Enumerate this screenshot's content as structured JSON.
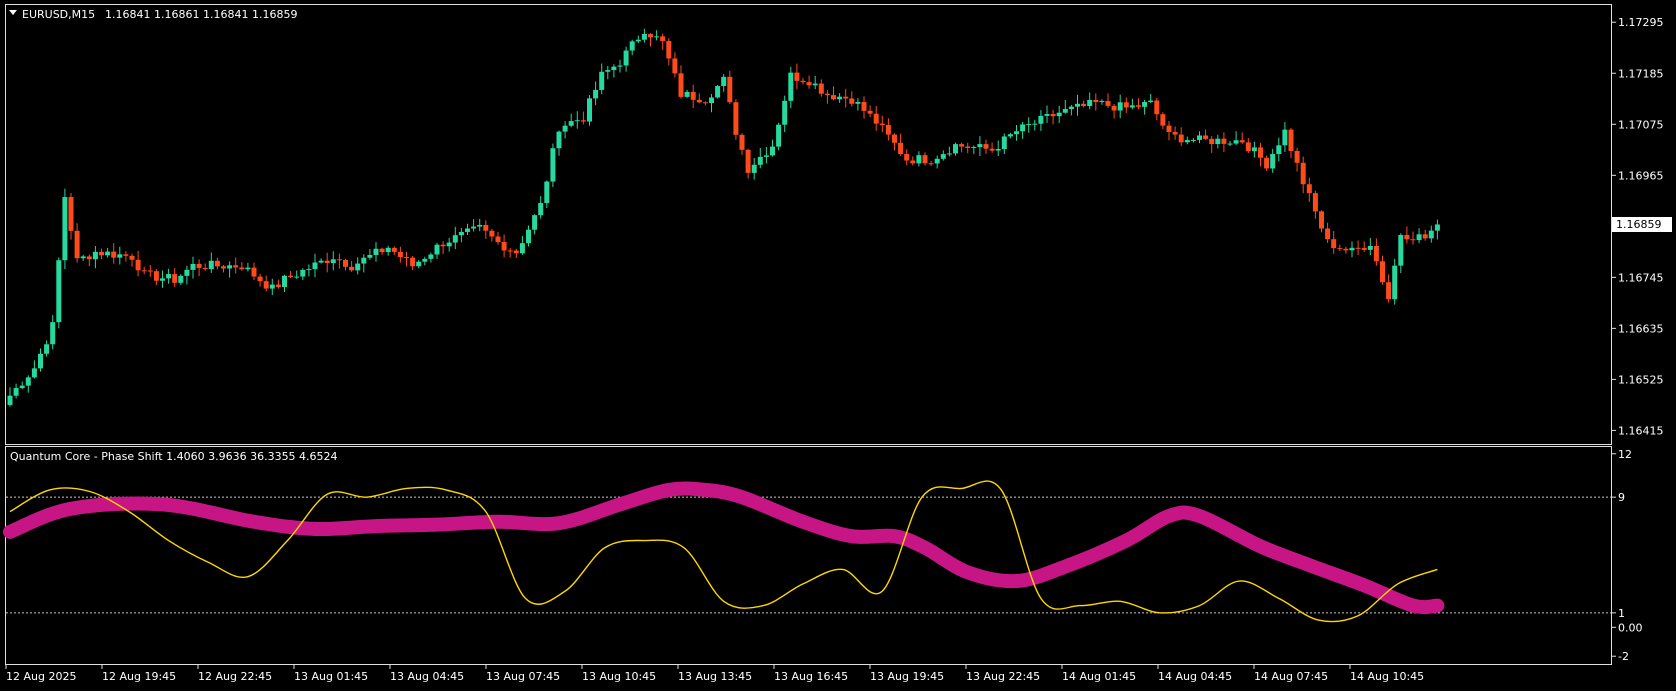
{
  "window": {
    "symbol_label": "EURUSD,M15",
    "ohlc_label": "1.16841 1.16861 1.16841 1.16859",
    "menu_icon": "triangle-down-icon"
  },
  "colors": {
    "background": "#000000",
    "bull": "#26d9a0",
    "bear": "#ff4a1c",
    "fast_line": "#ffd700",
    "slow_line": "#c71585",
    "frame": "#e0e0e0"
  },
  "price_axis": {
    "labels": [
      "1.17295",
      "1.17185",
      "1.17075",
      "1.16965",
      "1.16745",
      "1.16635",
      "1.16525",
      "1.16415"
    ],
    "current_price": "1.16859"
  },
  "indicator": {
    "title": "Quantum Core - Phase Shift 1.4060 3.9636 36.3355 4.6524",
    "axis_labels": [
      "12",
      "9",
      "1",
      "0.00",
      "-2"
    ],
    "levels": [
      9,
      1
    ]
  },
  "time_axis": {
    "labels": [
      "12 Aug 2025",
      "12 Aug 19:45",
      "12 Aug 22:45",
      "13 Aug 01:45",
      "13 Aug 04:45",
      "13 Aug 07:45",
      "13 Aug 10:45",
      "13 Aug 13:45",
      "13 Aug 16:45",
      "13 Aug 19:45",
      "13 Aug 22:45",
      "14 Aug 01:45",
      "14 Aug 04:45",
      "14 Aug 07:45",
      "14 Aug 10:45"
    ]
  },
  "chart_data": [
    {
      "type": "candlestick",
      "title": "EURUSD,M15",
      "ylim": [
        1.1639,
        1.1733
      ],
      "x_interval_minutes": 15,
      "first_bar": "12 Aug 2025 16:45",
      "last_bar": "14 Aug 12:45",
      "anchors": [
        {
          "bar": 0,
          "price": 1.1649
        },
        {
          "bar": 4,
          "price": 1.1655
        },
        {
          "bar": 7,
          "price": 1.1664
        },
        {
          "bar": 9,
          "price": 1.1692
        },
        {
          "bar": 11,
          "price": 1.1678
        },
        {
          "bar": 14,
          "price": 1.168
        },
        {
          "bar": 20,
          "price": 1.1679
        },
        {
          "bar": 22,
          "price": 1.1675
        },
        {
          "bar": 27,
          "price": 1.1674
        },
        {
          "bar": 30,
          "price": 1.1677
        },
        {
          "bar": 38,
          "price": 1.1677
        },
        {
          "bar": 43,
          "price": 1.1672
        },
        {
          "bar": 45,
          "price": 1.1674
        },
        {
          "bar": 53,
          "price": 1.1679
        },
        {
          "bar": 56,
          "price": 1.1677
        },
        {
          "bar": 62,
          "price": 1.1681
        },
        {
          "bar": 66,
          "price": 1.1677
        },
        {
          "bar": 71,
          "price": 1.1682
        },
        {
          "bar": 77,
          "price": 1.1685
        },
        {
          "bar": 80,
          "price": 1.1682
        },
        {
          "bar": 83,
          "price": 1.168
        },
        {
          "bar": 87,
          "price": 1.169
        },
        {
          "bar": 90,
          "price": 1.1707
        },
        {
          "bar": 94,
          "price": 1.1709
        },
        {
          "bar": 97,
          "price": 1.1718
        },
        {
          "bar": 100,
          "price": 1.1721
        },
        {
          "bar": 104,
          "price": 1.1728
        },
        {
          "bar": 107,
          "price": 1.1725
        },
        {
          "bar": 110,
          "price": 1.1714
        },
        {
          "bar": 114,
          "price": 1.1713
        },
        {
          "bar": 117,
          "price": 1.1717
        },
        {
          "bar": 119,
          "price": 1.1706
        },
        {
          "bar": 121,
          "price": 1.1698
        },
        {
          "bar": 125,
          "price": 1.1703
        },
        {
          "bar": 128,
          "price": 1.1718
        },
        {
          "bar": 131,
          "price": 1.1717
        },
        {
          "bar": 134,
          "price": 1.1714
        },
        {
          "bar": 138,
          "price": 1.1713
        },
        {
          "bar": 142,
          "price": 1.1708
        },
        {
          "bar": 147,
          "price": 1.17
        },
        {
          "bar": 151,
          "price": 1.17
        },
        {
          "bar": 155,
          "price": 1.1703
        },
        {
          "bar": 161,
          "price": 1.1702
        },
        {
          "bar": 165,
          "price": 1.1706
        },
        {
          "bar": 172,
          "price": 1.171
        },
        {
          "bar": 178,
          "price": 1.1712
        },
        {
          "bar": 183,
          "price": 1.1711
        },
        {
          "bar": 187,
          "price": 1.1712
        },
        {
          "bar": 190,
          "price": 1.1705
        },
        {
          "bar": 195,
          "price": 1.1704
        },
        {
          "bar": 202,
          "price": 1.1704
        },
        {
          "bar": 206,
          "price": 1.1699
        },
        {
          "bar": 209,
          "price": 1.1706
        },
        {
          "bar": 212,
          "price": 1.1695
        },
        {
          "bar": 216,
          "price": 1.1682
        },
        {
          "bar": 220,
          "price": 1.168
        },
        {
          "bar": 223,
          "price": 1.1682
        },
        {
          "bar": 226,
          "price": 1.167
        },
        {
          "bar": 228,
          "price": 1.1684
        },
        {
          "bar": 232,
          "price": 1.1683
        },
        {
          "bar": 234,
          "price": 1.16859
        }
      ]
    },
    {
      "type": "line",
      "title": "Quantum Core - Phase Shift 1.4060 3.9636 36.3355 4.6524",
      "ylim": [
        -2.4,
        12.4
      ],
      "x_bars": [
        0,
        10,
        25,
        40,
        50,
        60,
        70,
        80,
        90,
        100,
        108,
        114,
        120,
        130,
        138,
        145,
        150,
        157,
        165,
        173,
        183,
        190,
        195,
        205,
        213,
        222,
        230,
        234
      ],
      "series": [
        {
          "values": [
            6.6,
            8.2,
            8.5,
            7.3,
            6.8,
            7.0,
            7.1,
            7.3,
            7.2,
            8.5,
            9.5,
            9.5,
            9.0,
            7.3,
            6.3,
            6.3,
            5.5,
            3.8,
            3.2,
            4.2,
            6.0,
            7.7,
            7.7,
            5.6,
            4.3,
            2.9,
            1.5,
            1.5
          ]
        },
        {
          "values": [
            8.0,
            9.5,
            9.4,
            8.0,
            6.0,
            4.5,
            3.5,
            6.0,
            9.2,
            9.0,
            9.6,
            9.5,
            8.0,
            2.0,
            2.5,
            5.5,
            6.0,
            5.5,
            1.8,
            1.5,
            3.0,
            4.0,
            2.5,
            9.0,
            9.6,
            9.5,
            2.0,
            1.5,
            1.8,
            1.0,
            1.5,
            3.2,
            2.0,
            0.5,
            0.8,
            3.0,
            4.0
          ]
        }
      ]
    }
  ]
}
